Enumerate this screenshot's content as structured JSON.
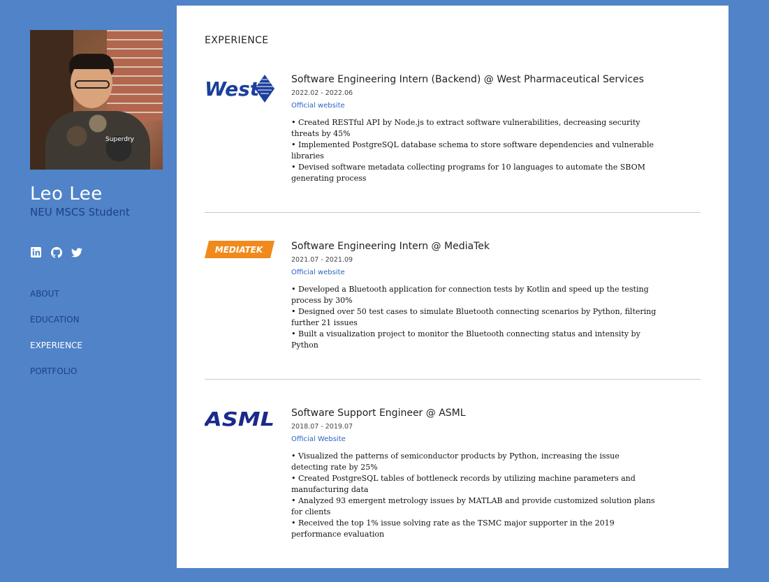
{
  "profile": {
    "name": "Leo Lee",
    "subtitle": "NEU MSCS Student",
    "avatar_shirt_text": "Superdry"
  },
  "socials": [
    {
      "icon": "linkedin-icon"
    },
    {
      "icon": "github-icon"
    },
    {
      "icon": "twitter-icon"
    }
  ],
  "nav": {
    "items": [
      {
        "label": "ABOUT",
        "active": false
      },
      {
        "label": "EDUCATION",
        "active": false
      },
      {
        "label": "EXPERIENCE",
        "active": true
      },
      {
        "label": "PORTFOLIO",
        "active": false
      }
    ]
  },
  "colors": {
    "page_bg": "#5083c8",
    "accent_dark": "#1e3f8a",
    "link": "#2a62c7",
    "west_blue": "#1b3f9c",
    "mediatek_orange": "#f08a1c",
    "asml_navy": "#1a2a8c"
  },
  "experience": {
    "section_title": "EXPERIENCE",
    "entries": [
      {
        "logo_text": "West",
        "title": "Software Engineering Intern (Backend) @ West Pharmaceutical Services",
        "dates": "2022.02 - 2022.06",
        "link_label": "Official website",
        "bullets": [
          "• Created RESTful API by Node.js to extract software vulnerabilities, decreasing security threats by 45%",
          "• Implemented PostgreSQL database schema to store software dependencies and vulnerable libraries",
          "• Devised software metadata collecting programs for 10 languages to automate the SBOM generating process"
        ]
      },
      {
        "logo_text": "MEDIATEK",
        "title": "Software Engineering Intern @ MediaTek",
        "dates": "2021.07 - 2021.09",
        "link_label": "Official website",
        "bullets": [
          "• Developed a Bluetooth application for connection tests by Kotlin and speed up the testing process by 30%",
          "• Designed over 50 test cases to simulate Bluetooth connecting scenarios by Python, filtering further 21 issues",
          "• Built a visualization project to monitor the Bluetooth connecting status and intensity by Python"
        ]
      },
      {
        "logo_text": "ASML",
        "title": "Software Support Engineer @ ASML",
        "dates": "2018.07 - 2019.07",
        "link_label": "Official Website",
        "bullets": [
          "• Visualized the patterns of semiconductor products by Python, increasing the issue detecting rate by 25%",
          "• Created PostgreSQL tables of bottleneck records by utilizing machine parameters and manufacturing data",
          "• Analyzed 93 emergent metrology issues by MATLAB and provide customized solution plans for clients",
          "• Received the top 1% issue solving rate as the TSMC major supporter in the 2019 performance evaluation"
        ]
      }
    ]
  }
}
